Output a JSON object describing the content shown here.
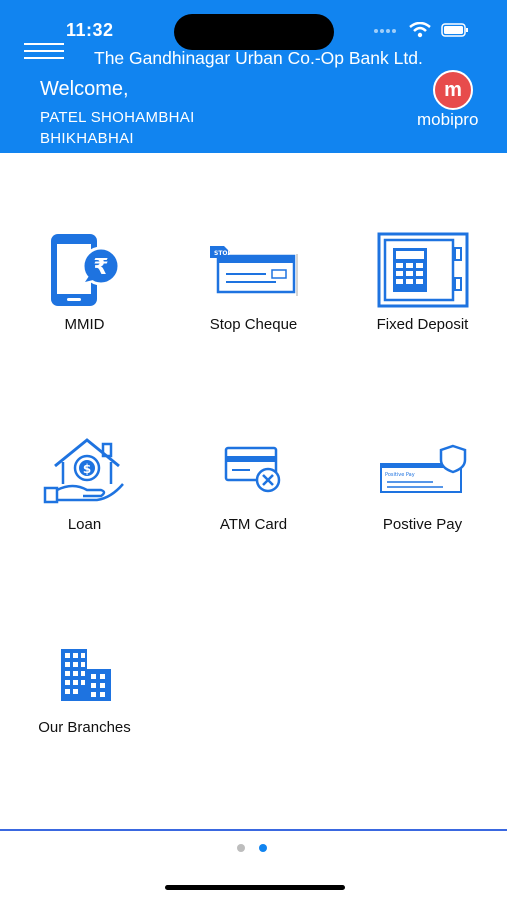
{
  "status": {
    "time": "11:32"
  },
  "header": {
    "bank_name": "The Gandhinagar Urban Co.-Op Bank Ltd.",
    "welcome": "Welcome,",
    "user_line1": "PATEL SHOHAMBHAI",
    "user_line2": "BHIKHABHAI",
    "logo_letter": "m",
    "logo_text": "mobipro",
    "background_color": "#1184f0"
  },
  "menu": [
    {
      "label": "MMID",
      "icon": "mobile-rupee-icon"
    },
    {
      "label": "Stop Cheque",
      "icon": "stop-cheque-icon"
    },
    {
      "label": "Fixed Deposit",
      "icon": "safe-locker-icon"
    },
    {
      "label": "Loan",
      "icon": "home-loan-icon"
    },
    {
      "label": "ATM Card",
      "icon": "atm-card-icon"
    },
    {
      "label": "Postive Pay",
      "icon": "positive-pay-cheque-icon"
    },
    {
      "label": "Our Branches",
      "icon": "buildings-icon"
    }
  ],
  "pagination": {
    "pages": 2,
    "active_page": 2,
    "active_color": "#1184f0",
    "inactive_color": "#bdbdbd"
  }
}
